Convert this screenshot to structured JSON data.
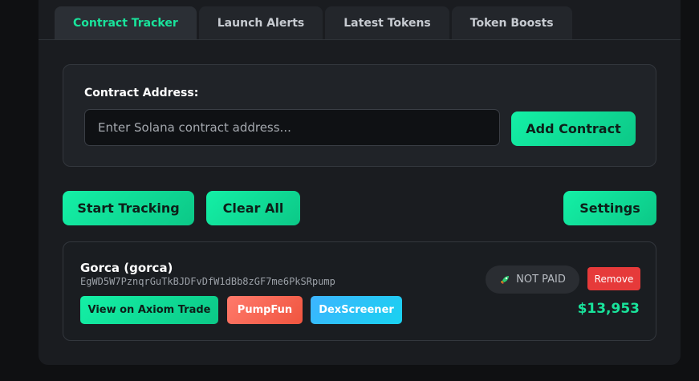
{
  "tabs": [
    {
      "label": "Contract Tracker",
      "active": true
    },
    {
      "label": "Launch Alerts",
      "active": false
    },
    {
      "label": "Latest Tokens",
      "active": false
    },
    {
      "label": "Token Boosts",
      "active": false
    }
  ],
  "contract_form": {
    "label": "Contract Address:",
    "placeholder": "Enter Solana contract address...",
    "value": "",
    "add_button": "Add Contract"
  },
  "actions": {
    "start_tracking": "Start Tracking",
    "clear_all": "Clear All",
    "settings": "Settings"
  },
  "token": {
    "name": "Gorca (gorca)",
    "address": "EgWD5W7PznqrGuTkBJDFvDfW1dBb8zGF7me6PkSRpump",
    "links": {
      "axiom": "View on Axiom Trade",
      "pumpfun": "PumpFun",
      "dexscreener": "DexScreener"
    },
    "status_icon": "rocket-icon",
    "status": "NOT PAID",
    "remove": "Remove",
    "price": "$13,953"
  },
  "colors": {
    "accent": "#19e39b",
    "danger": "#e63a3a",
    "pumpfun": "#f0553f",
    "dexscreener": "#19d2f0",
    "panel_bg": "#1a1c20"
  }
}
